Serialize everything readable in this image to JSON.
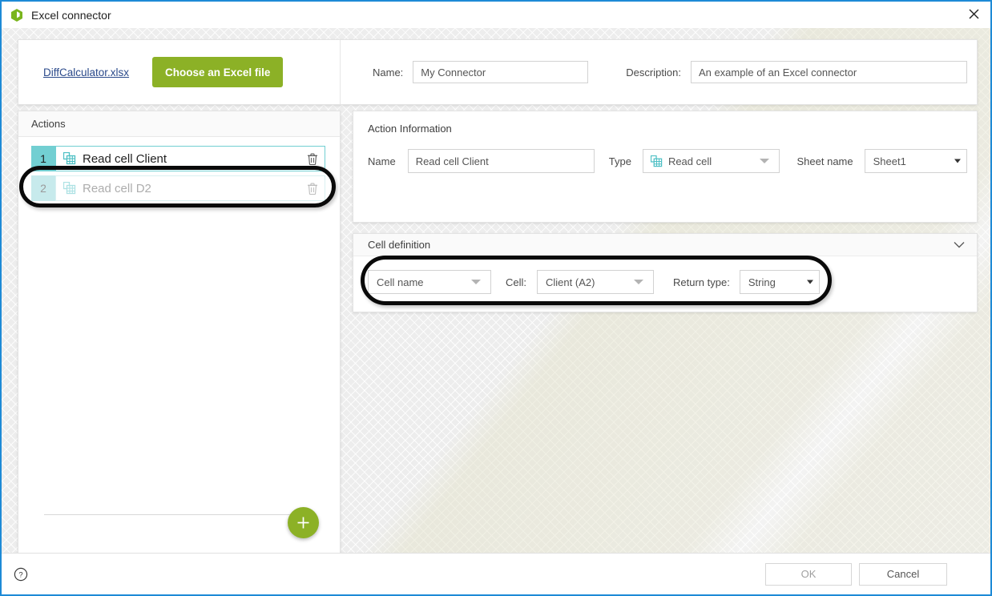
{
  "window": {
    "title": "Excel connector",
    "app_icon": "excel-hexagon-icon",
    "close_icon": "close-icon",
    "accent_border": "#1e8ad6"
  },
  "file_bar": {
    "file_link": "DiffCalculator.xlsx",
    "choose_button": "Choose an Excel file",
    "choose_button_color": "#8cb126",
    "name_label": "Name:",
    "name_value": "My Connector",
    "description_label": "Description:",
    "description_value": "An example of an Excel connector"
  },
  "actions_panel": {
    "header": "Actions",
    "add_button_icon": "plus-icon",
    "add_button_color": "#8cb126",
    "items": [
      {
        "number": "1",
        "label": "Read cell Client",
        "icon": "read-cell-icon",
        "delete_icon": "trash-icon",
        "selected": true,
        "badge_color": "#72cfd2"
      },
      {
        "number": "2",
        "label": "Read cell D2",
        "icon": "read-cell-icon",
        "delete_icon": "trash-icon",
        "selected": false,
        "badge_color": "#c7eaec"
      }
    ]
  },
  "action_information": {
    "title": "Action Information",
    "name_label": "Name",
    "name_value": "Read cell Client",
    "type_label": "Type",
    "type_value": "Read cell",
    "type_icon": "read-cell-icon",
    "sheet_label": "Sheet name",
    "sheet_value": "Sheet1"
  },
  "cell_definition": {
    "title": "Cell definition",
    "collapse_icon": "chevron-down-icon",
    "mode_value": "Cell name",
    "cell_label": "Cell:",
    "cell_value": "Client (A2)",
    "return_type_label": "Return type:",
    "return_type_value": "String"
  },
  "footer": {
    "help_icon": "help-circle-icon",
    "ok_label": "OK",
    "cancel_label": "Cancel"
  }
}
